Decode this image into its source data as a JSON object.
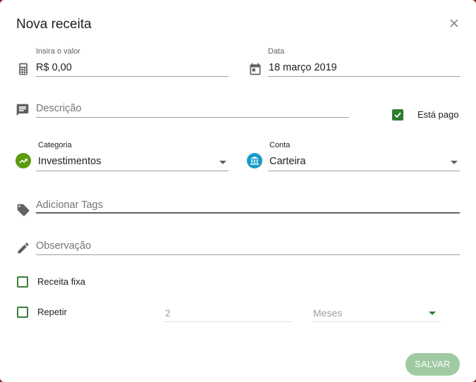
{
  "dialog": {
    "title": "Nova receita",
    "close_icon": "close-icon"
  },
  "value_field": {
    "label": "Insira o valor",
    "value": "R$ 0,00",
    "icon": "calculator-icon"
  },
  "date_field": {
    "label": "Data",
    "value": "18 março 2019",
    "icon": "calendar-icon"
  },
  "description_field": {
    "placeholder": "Descrição",
    "icon": "description-icon"
  },
  "paid_toggle": {
    "label": "Está pago",
    "checked": true
  },
  "category_field": {
    "label": "Categoria",
    "value": "Investimentos",
    "icon": "trending-up-icon",
    "color": "#5c9a0e"
  },
  "account_field": {
    "label": "Conta",
    "value": "Carteira",
    "icon": "bank-icon",
    "color": "#1a9bc7"
  },
  "tags_field": {
    "placeholder": "Adicionar Tags",
    "icon": "tag-icon"
  },
  "notes_field": {
    "placeholder": "Observação",
    "icon": "pencil-icon"
  },
  "fixed_income": {
    "label": "Receita fixa",
    "checked": false
  },
  "repeat": {
    "label": "Repetir",
    "checked": false,
    "count": "2",
    "period": "Meses"
  },
  "save_button": {
    "label": "SALVAR"
  },
  "colors": {
    "accent": "#2e7d32",
    "button": "#9fcaa2",
    "backdrop": "#8a1c1c"
  }
}
